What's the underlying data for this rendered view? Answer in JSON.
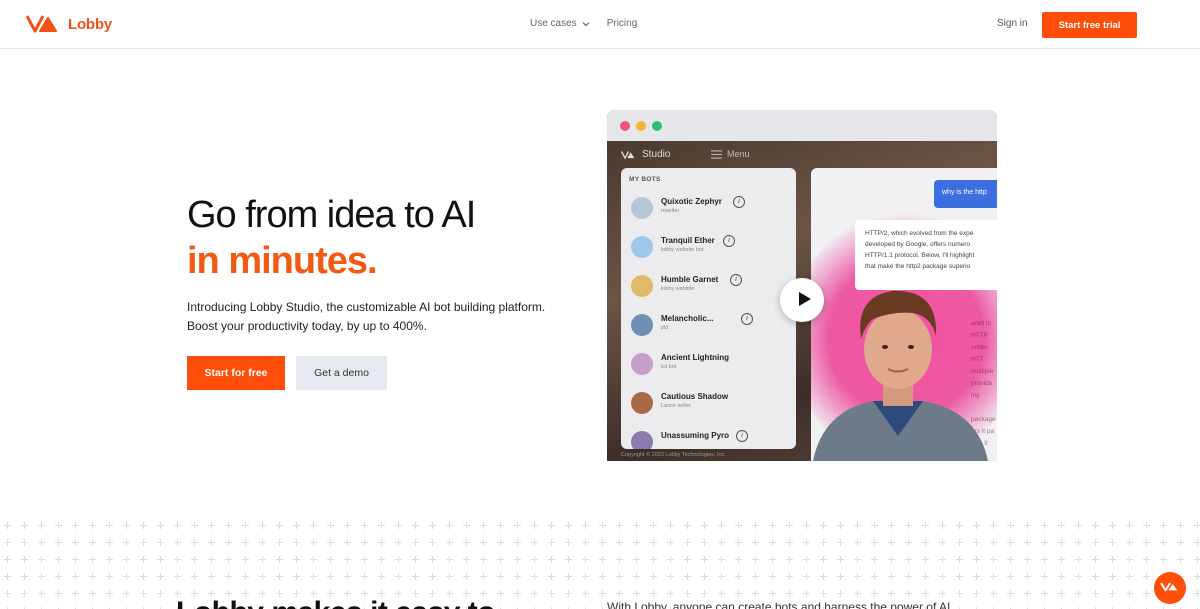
{
  "brand": {
    "name": "Lobby",
    "color": "#f0521a"
  },
  "nav": {
    "items": [
      {
        "label": "Use cases",
        "has_dropdown": true
      },
      {
        "label": "Pricing",
        "has_dropdown": false
      }
    ],
    "signin_label": "Sign in",
    "trial_label": "Start free trial"
  },
  "hero": {
    "title_line1": "Go from idea to AI",
    "title_line2": "in minutes.",
    "subtitle_line1": "Introducing Lobby Studio, the customizable AI bot building platform.",
    "subtitle_line2": "Boost your productivity today, by up to 400%.",
    "primary_cta": "Start for free",
    "secondary_cta": "Get a demo"
  },
  "mock": {
    "app_name": "Studio",
    "menu_label": "Menu",
    "bots_heading": "MY BOTS",
    "bots": [
      {
        "name": "Quixotic Zephyr",
        "desc": "rewriter",
        "avatar": "robot-icon"
      },
      {
        "name": "Tranquil Ether",
        "desc": "lobby website bot",
        "avatar": "dolphin-icon"
      },
      {
        "name": "Humble Garnet",
        "desc": "lobby website",
        "avatar": "giraffe-icon"
      },
      {
        "name": "Melancholic...",
        "desc": "pld",
        "avatar": "whale-icon"
      },
      {
        "name": "Ancient Lightning",
        "desc": "tut bot",
        "avatar": "orb-icon"
      },
      {
        "name": "Cautious Shadow",
        "desc": "Lance seller",
        "avatar": "eagle-icon"
      },
      {
        "name": "Unassuming Pyro",
        "desc": "",
        "avatar": "creature-icon"
      }
    ],
    "user_message": "why is the http",
    "bot_message_lines": [
      "HTTP/2, which evolved from the expe",
      "developed by Google, offers numero",
      "HTTP/1.1 protocol. Below, I'll highlight",
      "that make the http2 package superio"
    ],
    "faded_lines": [
      "ared to HTTP",
      "under, HTT",
      "multiple",
      "provide",
      "ing",
      "",
      "package",
      "ers it pa",
      "ows it"
    ],
    "copyright": "Copyright © 2023 Lobby Technologies, Inc."
  },
  "section": {
    "title": "Lobby makes it easy to",
    "subtitle": "With Lobby, anyone can create bots and harness the power of AI"
  },
  "colors": {
    "accent": "#ff4d0a",
    "accent_text": "#f25a14",
    "secondary_btn": "#e6e9ef",
    "glow": "#ec4096"
  }
}
